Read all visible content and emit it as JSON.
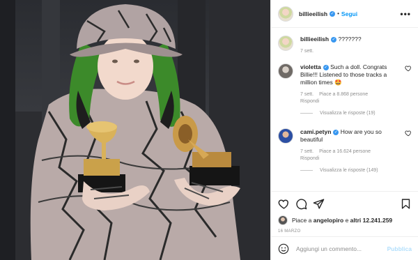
{
  "post": {
    "username": "billieeilish",
    "follow_label": "Segui",
    "separator": "•",
    "more_label": "•••"
  },
  "caption": {
    "username": "billieeilish",
    "text": "???????",
    "time": "7 sett."
  },
  "comments": [
    {
      "username": "violetta",
      "text": "Such a doll. Congrats Billie!!! Listened to those tracks a million times 🤩",
      "time": "7 sett.",
      "likes": "Piace a 8.868 persone",
      "reply_label": "Rispondi",
      "view_replies": "Visualizza le risposte (19)"
    },
    {
      "username": "cami.petyn",
      "text": "How are you so beautiful",
      "time": "7 sett.",
      "likes": "Piace a 16.624 persone",
      "reply_label": "Rispondi",
      "view_replies": "Visualizza le risposte (149)"
    }
  ],
  "likes": {
    "prefix": "Piace a ",
    "user": "angelopiro",
    "middle": " e ",
    "others": "altri 12.241.259"
  },
  "date": "16 MARZO",
  "add_comment": {
    "placeholder": "Aggiungi un commento...",
    "publish_label": "Pubblica"
  },
  "colors": {
    "accent": "#0095f6",
    "verified": "#3897f0",
    "publish_disabled": "#b2dffc",
    "muted_text": "#8e8e8e"
  },
  "icons": [
    "heart-icon",
    "comment-icon",
    "share-icon",
    "bookmark-icon",
    "emoji-icon",
    "verified-icon",
    "more-icon"
  ]
}
